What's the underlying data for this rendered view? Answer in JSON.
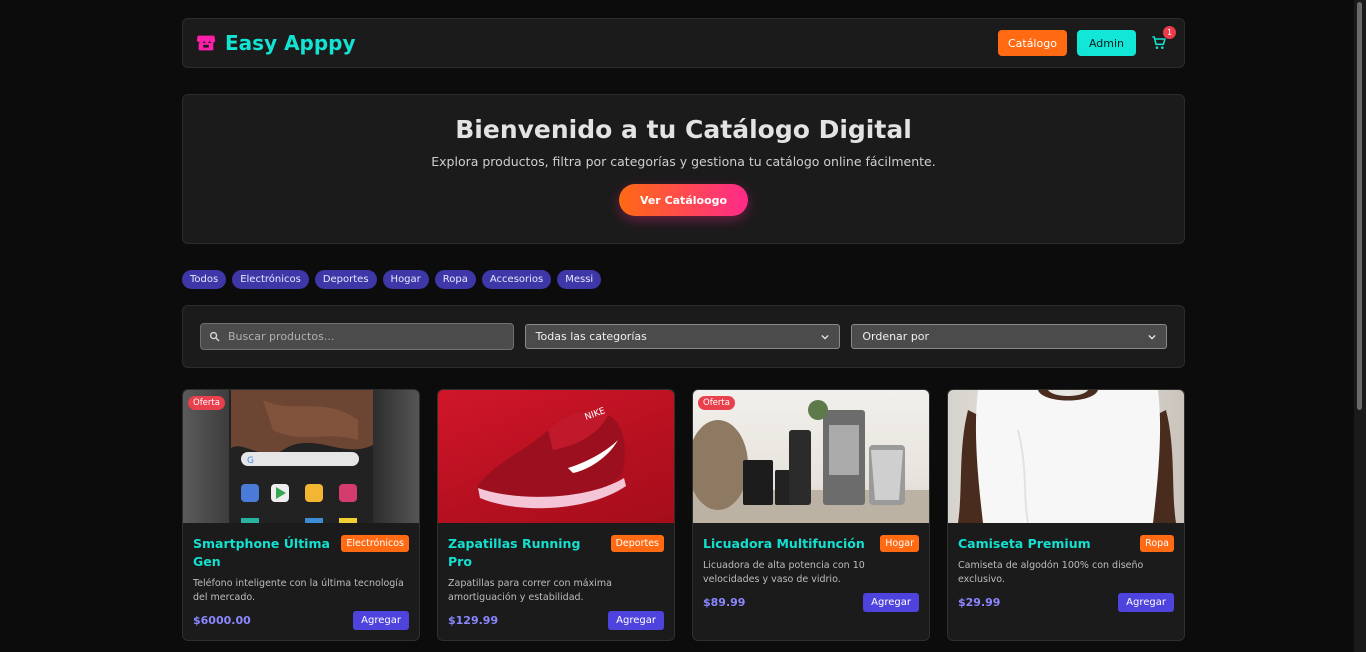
{
  "brand": {
    "name": "Easy Apppy",
    "icon": "store-icon"
  },
  "nav": {
    "catalog_label": "Catálogo",
    "admin_label": "Admin",
    "cart_count": "1"
  },
  "hero": {
    "title": "Bienvenido a tu Catálogo Digital",
    "subtitle": "Explora productos, filtra por categorías y gestiona tu catálogo online fácilmente.",
    "button": "Ver Catáloogo"
  },
  "chips": [
    "Todos",
    "Electrónicos",
    "Deportes",
    "Hogar",
    "Ropa",
    "Accesorios",
    "Messi"
  ],
  "filters": {
    "search_placeholder": "Buscar productos...",
    "category_selected": "Todas las categorías",
    "sort_selected": "Ordenar por"
  },
  "products": [
    {
      "title": "Smartphone Última Gen",
      "category": "Electrónicos",
      "description": "Teléfono inteligente con la última tecnología del mercado.",
      "price": "$6000.00",
      "button": "Agregar",
      "badge": "Oferta"
    },
    {
      "title": "Zapatillas Running Pro",
      "category": "Deportes",
      "description": "Zapatillas para correr con máxima amortiguación y estabilidad.",
      "price": "$129.99",
      "button": "Agregar",
      "badge": ""
    },
    {
      "title": "Licuadora Multifunción",
      "category": "Hogar",
      "description": "Licuadora de alta potencia con 10 velocidades y vaso de vidrio.",
      "price": "$89.99",
      "button": "Agregar",
      "badge": "Oferta"
    },
    {
      "title": "Camiseta Premium",
      "category": "Ropa",
      "description": "Camiseta de algodón 100% con diseño exclusivo.",
      "price": "$29.99",
      "button": "Agregar",
      "badge": ""
    }
  ],
  "colors": {
    "accent_teal": "#13e3d3",
    "accent_orange": "#ff6a13",
    "accent_purple": "#4f43dd",
    "background": "#0c0c0c"
  }
}
